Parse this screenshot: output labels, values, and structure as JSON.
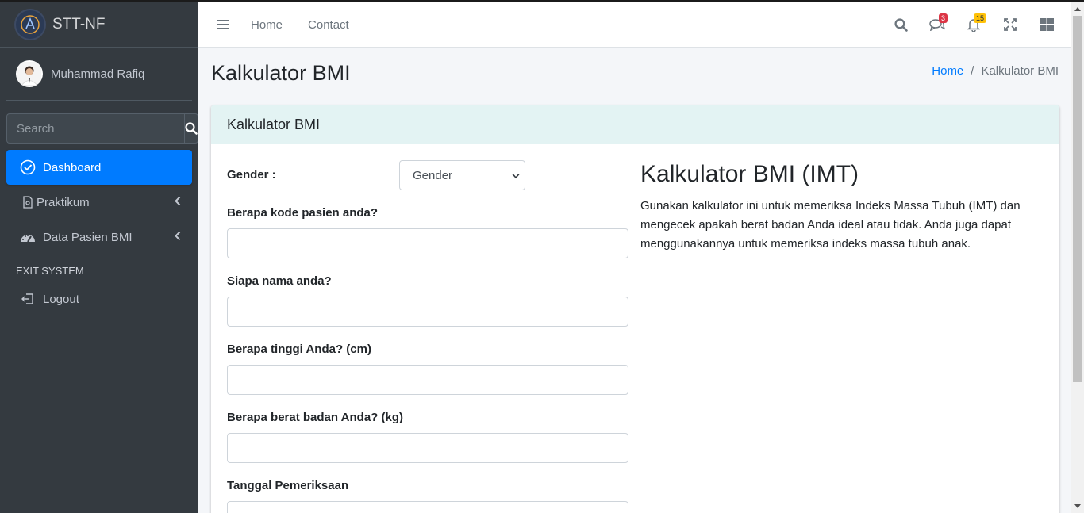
{
  "brand": {
    "name": "STT-NF"
  },
  "user": {
    "name": "Muhammad Rafiq"
  },
  "sidebar": {
    "search_placeholder": "Search",
    "items": [
      {
        "label": "Dashboard",
        "icon": "check-circle-icon",
        "active": true
      },
      {
        "label": "Praktikum",
        "icon": "file-icon",
        "has_children": true
      },
      {
        "label": "Data Pasien BMI",
        "icon": "tachometer-icon",
        "has_children": true
      }
    ],
    "section_header": "EXIT SYSTEM",
    "logout_label": "Logout"
  },
  "topnav": {
    "links": [
      "Home",
      "Contact"
    ],
    "messages_badge": "3",
    "notifications_badge": "15",
    "icons": [
      "search-icon",
      "comments-icon",
      "bell-icon",
      "expand-icon",
      "grid-icon"
    ]
  },
  "page": {
    "title": "Kalkulator BMI",
    "breadcrumb": {
      "home": "Home",
      "separator": "/",
      "current": "Kalkulator BMI"
    }
  },
  "card": {
    "header": "Kalkulator BMI",
    "form": {
      "gender_label": "Gender :",
      "gender_select_value": "Gender",
      "fields": [
        {
          "label": "Berapa kode pasien anda?",
          "value": ""
        },
        {
          "label": "Siapa nama anda?",
          "value": ""
        },
        {
          "label": "Berapa tinggi Anda? (cm)",
          "value": ""
        },
        {
          "label": "Berapa berat badan Anda? (kg)",
          "value": ""
        },
        {
          "label": "Tanggal Pemeriksaan",
          "value": ""
        }
      ]
    },
    "info": {
      "title": "Kalkulator BMI (IMT)",
      "text": "Gunakan kalkulator ini untuk memeriksa Indeks Massa Tubuh (IMT) dan mengecek apakah berat badan Anda ideal atau tidak. Anda juga dapat menggunakannya untuk memeriksa indeks massa tubuh anak."
    }
  },
  "colors": {
    "sidebar_bg": "#343a40",
    "active": "#007bff",
    "card_header_bg": "#e3f3f3"
  }
}
